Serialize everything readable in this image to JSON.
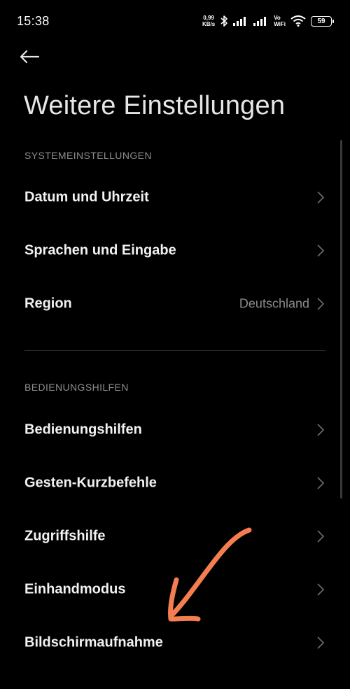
{
  "status_bar": {
    "time": "15:38",
    "net_speed_value": "0,99",
    "net_speed_unit": "KB/s",
    "volte_line1": "Vo",
    "volte_line2": "WiFi",
    "battery": "59"
  },
  "header": {
    "title": "Weitere Einstellungen"
  },
  "sections": {
    "system": {
      "header": "SYSTEMEINSTELLUNGEN",
      "items": [
        {
          "label": "Datum und Uhrzeit"
        },
        {
          "label": "Sprachen und Eingabe"
        },
        {
          "label": "Region",
          "value": "Deutschland"
        }
      ]
    },
    "accessibility": {
      "header": "BEDIENUNGSHILFEN",
      "items": [
        {
          "label": "Bedienungshilfen"
        },
        {
          "label": "Gesten-Kurzbefehle"
        },
        {
          "label": "Zugriffshilfe"
        },
        {
          "label": "Einhandmodus"
        },
        {
          "label": "Bildschirmaufnahme"
        }
      ]
    }
  },
  "colors": {
    "background": "#000000",
    "annotation_arrow": "#f47e4f"
  }
}
